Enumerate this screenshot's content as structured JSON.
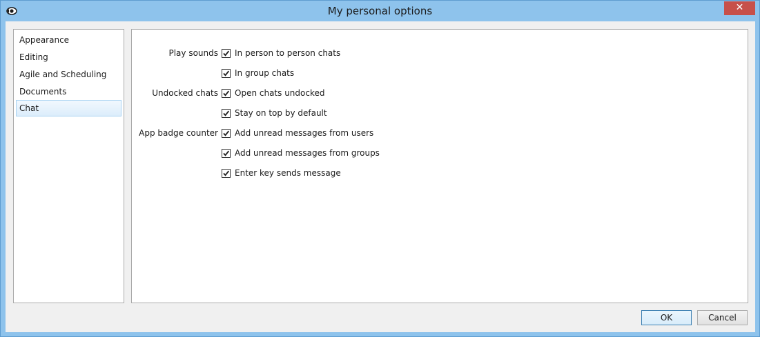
{
  "window": {
    "title": "My personal options",
    "close_label": "✕"
  },
  "sidebar": {
    "items": [
      {
        "label": "Appearance",
        "selected": false
      },
      {
        "label": "Editing",
        "selected": false
      },
      {
        "label": "Agile and Scheduling",
        "selected": false
      },
      {
        "label": "Documents",
        "selected": false
      },
      {
        "label": "Chat",
        "selected": true
      }
    ]
  },
  "options": {
    "groups": [
      {
        "label": "Play sounds"
      },
      {
        "label": "Undocked chats"
      },
      {
        "label": "App badge counter"
      }
    ],
    "checkboxes": [
      {
        "label": "In person to person chats",
        "checked": true
      },
      {
        "label": "In group chats",
        "checked": true
      },
      {
        "label": "Open chats undocked",
        "checked": true
      },
      {
        "label": "Stay on top by default",
        "checked": true
      },
      {
        "label": "Add unread messages from users",
        "checked": true
      },
      {
        "label": "Add unread messages from groups",
        "checked": true
      },
      {
        "label": "Enter key sends message",
        "checked": true
      }
    ]
  },
  "buttons": {
    "ok": "OK",
    "cancel": "Cancel"
  }
}
